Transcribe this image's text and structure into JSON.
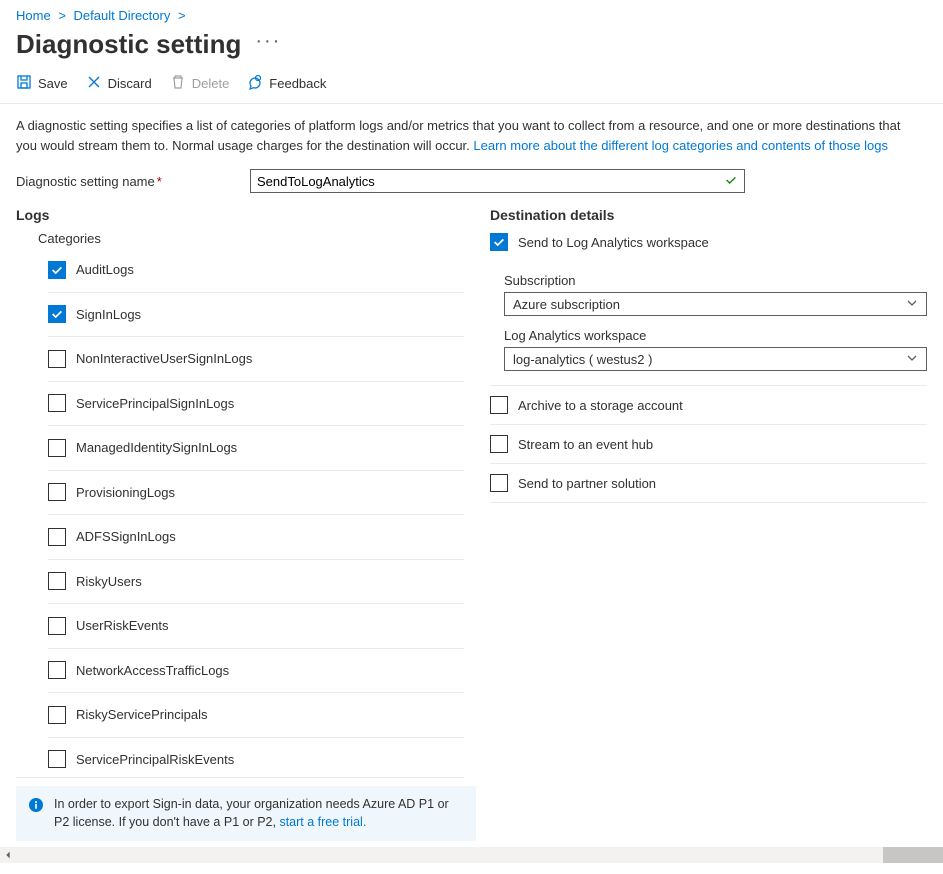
{
  "breadcrumb": {
    "items": [
      "Home",
      "Default Directory"
    ]
  },
  "page": {
    "title": "Diagnostic setting",
    "ellipsis": "···"
  },
  "toolbar": {
    "save": "Save",
    "discard": "Discard",
    "delete": "Delete",
    "feedback": "Feedback"
  },
  "description": {
    "text": "A diagnostic setting specifies a list of categories of platform logs and/or metrics that you want to collect from a resource, and one or more destinations that you would stream them to. Normal usage charges for the destination will occur. ",
    "link": "Learn more about the different log categories and contents of those logs"
  },
  "name_field": {
    "label": "Diagnostic setting name",
    "value": "SendToLogAnalytics"
  },
  "logs": {
    "section_title": "Logs",
    "categories_title": "Categories",
    "categories": [
      {
        "label": "AuditLogs",
        "checked": true
      },
      {
        "label": "SignInLogs",
        "checked": true
      },
      {
        "label": "NonInteractiveUserSignInLogs",
        "checked": false
      },
      {
        "label": "ServicePrincipalSignInLogs",
        "checked": false
      },
      {
        "label": "ManagedIdentitySignInLogs",
        "checked": false
      },
      {
        "label": "ProvisioningLogs",
        "checked": false
      },
      {
        "label": "ADFSSignInLogs",
        "checked": false
      },
      {
        "label": "RiskyUsers",
        "checked": false
      },
      {
        "label": "UserRiskEvents",
        "checked": false
      },
      {
        "label": "NetworkAccessTrafficLogs",
        "checked": false
      },
      {
        "label": "RiskyServicePrincipals",
        "checked": false
      },
      {
        "label": "ServicePrincipalRiskEvents",
        "checked": false
      }
    ]
  },
  "destinations": {
    "section_title": "Destination details",
    "log_analytics": {
      "label": "Send to Log Analytics workspace",
      "checked": true,
      "subscription_label": "Subscription",
      "subscription_value": "Azure subscription",
      "workspace_label": "Log Analytics workspace",
      "workspace_value": "log-analytics  ( westus2 )"
    },
    "storage": {
      "label": "Archive to a storage account",
      "checked": false
    },
    "eventhub": {
      "label": "Stream to an event hub",
      "checked": false
    },
    "partner": {
      "label": "Send to partner solution",
      "checked": false
    }
  },
  "info_banner": {
    "text": "In order to export Sign-in data, your organization needs Azure AD P1 or P2 license. If you don't have a P1 or P2, ",
    "link": "start a free trial."
  }
}
